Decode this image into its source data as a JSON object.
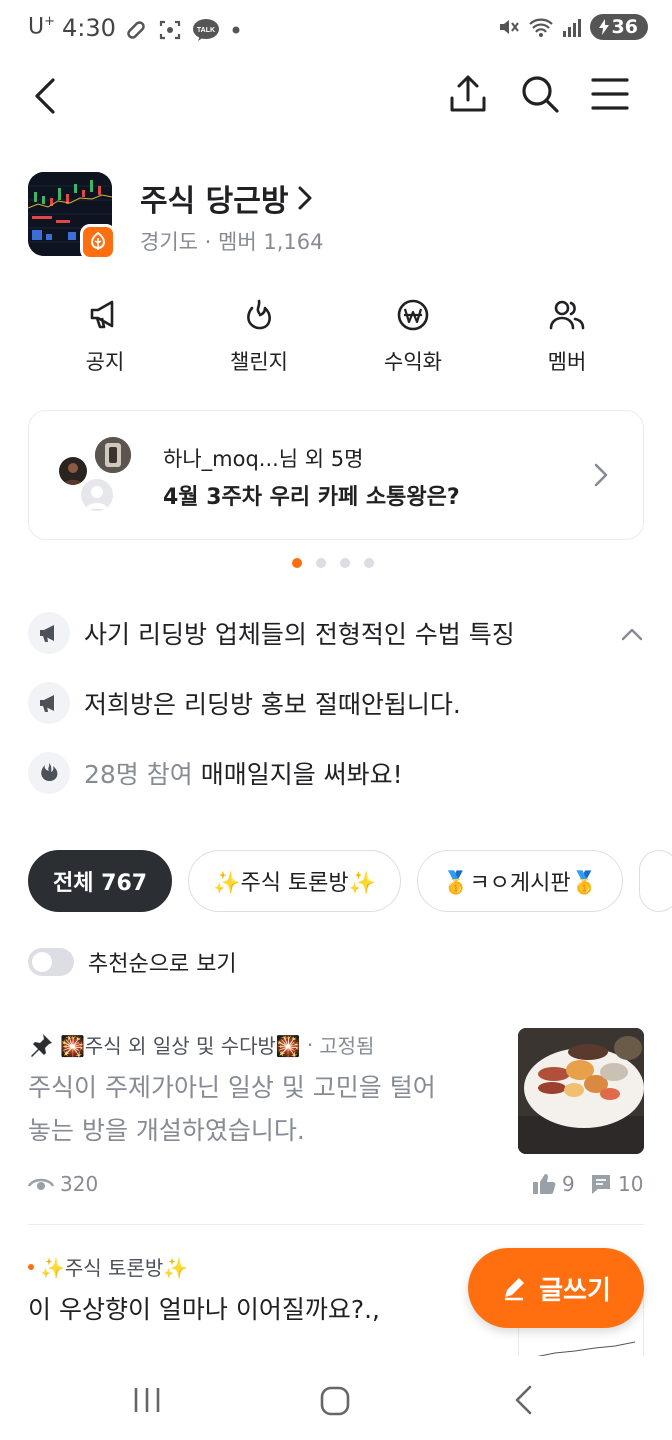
{
  "status_bar": {
    "carrier": "U",
    "carrier_sup": "+",
    "time": "4:30",
    "battery": "36"
  },
  "cafe": {
    "name": "주식 당근방",
    "region": "경기도",
    "members_label": "멤버",
    "members_count": "1,164"
  },
  "quick_menu": [
    {
      "label": "공지",
      "icon": "megaphone-icon"
    },
    {
      "label": "챌린지",
      "icon": "flame-icon"
    },
    {
      "label": "수익화",
      "icon": "won-coin-icon"
    },
    {
      "label": "멤버",
      "icon": "users-icon"
    }
  ],
  "banner": {
    "subtitle": "하나_moq...님 외 5명",
    "title": "4월 3주차 우리 카페 소통왕은?",
    "pages": 4,
    "active_page": 1
  },
  "notices": [
    {
      "text": "사기 리딩방 업체들의 전형적인 수법 특징",
      "icon": "megaphone-icon"
    },
    {
      "text": "저희방은 리딩방 홍보 절때안됩니다.",
      "icon": "megaphone-icon"
    },
    {
      "prefix": "28명 참여",
      "text": "매매일지을 써봐요!",
      "icon": "flame-icon"
    }
  ],
  "tabs": [
    {
      "label": "전체 767",
      "active": true
    },
    {
      "label": "✨주식 토론방✨",
      "active": false
    },
    {
      "label": "🥇ㅋㅇ게시판🥇",
      "active": false
    }
  ],
  "sort_toggle": {
    "label": "추천순으로 보기",
    "on": false
  },
  "posts": [
    {
      "category": "🎇주식 외 일상 및 수다방🎇",
      "pinned_label": "고정됨",
      "body_line1": "주식이 주제가아닌 일상 및 고민을 털어",
      "body_line2": "놓는 방을 개설하였습니다.",
      "views": "320",
      "likes": "9",
      "comments": "10"
    },
    {
      "category": "✨주식 토론방✨",
      "title": "이 우상향이 얼마나 이어질까요?.,"
    }
  ],
  "fab_label": "글쓰기",
  "colors": {
    "accent": "#ff6f0f",
    "dark": "#2b2e33",
    "grey": "#868b94"
  }
}
